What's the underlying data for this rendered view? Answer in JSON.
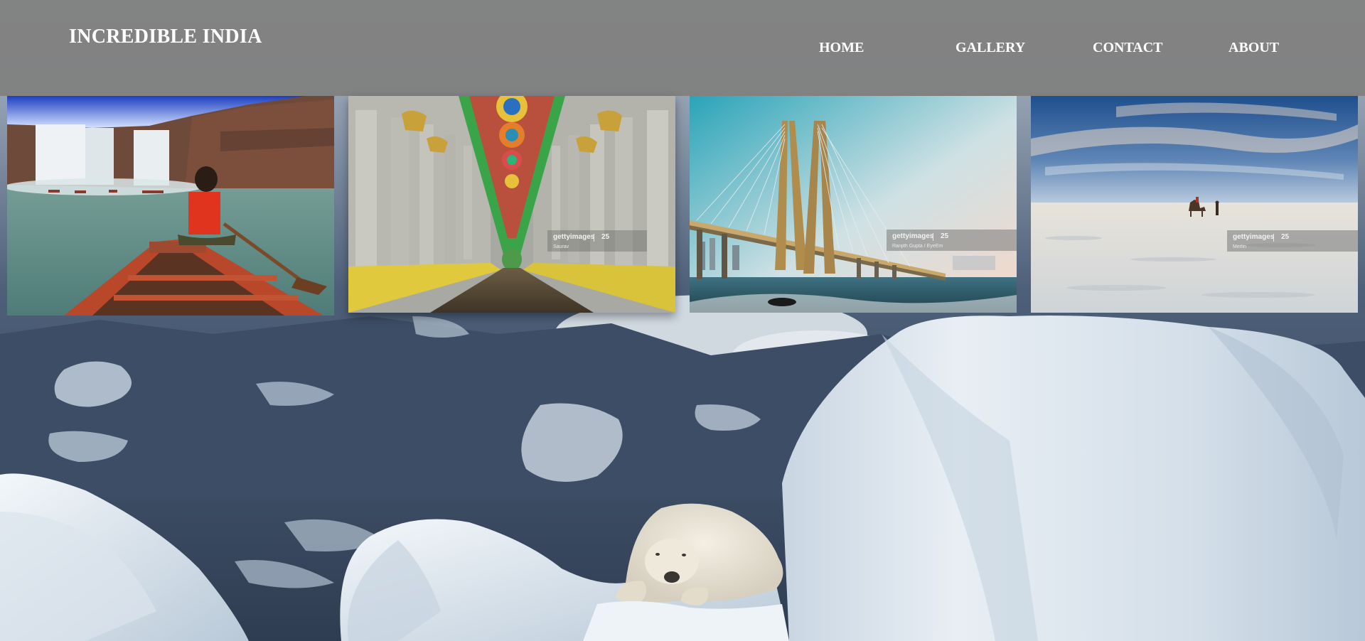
{
  "header": {
    "brand": "INCREDIBLE INDIA",
    "nav": [
      {
        "label": "HOME"
      },
      {
        "label": "GALLERY"
      },
      {
        "label": "CONTACT"
      },
      {
        "label": "ABOUT"
      }
    ]
  },
  "gallery": {
    "tiles": [
      {
        "subject": "waterfall-boat-photo"
      },
      {
        "subject": "temple-corridor-photo",
        "watermark": {
          "brand": "gettyimages",
          "number": "25",
          "credit": "Saurav"
        }
      },
      {
        "subject": "sea-link-bridge-photo",
        "watermark": {
          "brand": "gettyimages",
          "number": "25",
          "credit": "Ranjith Gupta / EyeEm"
        }
      },
      {
        "subject": "salt-desert-camel-photo",
        "watermark": {
          "brand": "gettyimages",
          "number": "25",
          "credit": "Merlin"
        }
      }
    ]
  },
  "background": {
    "subject": "polar-bear-on-ice-photo"
  }
}
